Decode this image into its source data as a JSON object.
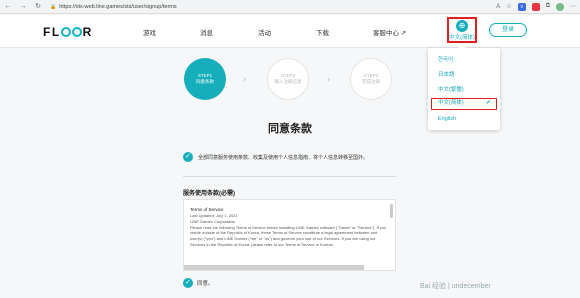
{
  "browser": {
    "url": "https://sts-web.line.games/sts/user/signup/terms"
  },
  "header": {
    "logo": [
      "FL",
      "O",
      "O",
      "R"
    ],
    "menu": [
      {
        "label": "游戏"
      },
      {
        "label": "消息"
      },
      {
        "label": "活动"
      },
      {
        "label": "下载"
      },
      {
        "label": "客服中心 ↗"
      }
    ],
    "language_button": "中文(简体)",
    "login": "登录"
  },
  "language_dropdown": {
    "options": [
      {
        "label": "한국어"
      },
      {
        "label": "日本語"
      },
      {
        "label": "中文(繁體)"
      },
      {
        "label": "中文(简体)",
        "selected": true
      },
      {
        "label": "English"
      }
    ]
  },
  "steps": [
    {
      "num": "STEP1",
      "label": "同意条款",
      "active": true
    },
    {
      "num": "STEP2",
      "label": "输入注册信息",
      "active": false
    },
    {
      "num": "STEP3",
      "label": "完成注册",
      "active": false
    }
  ],
  "page_title": "同意条款",
  "agree_all": "全部同意服务使用条款、收集及使用个人信息指南、将个人信息转移至国外。",
  "tos": {
    "section_title": "服务使用条款(必需)",
    "heading": "Terms of Service",
    "updated": "Last Updated: July 1, 2021",
    "company": "LINE Games Corporation",
    "body": "Please read the following Terms of Service before installing LINE Games software (\"Game\" or \"Service\"). If you reside outside of the Republic of Korea, these Terms of Service constitute a legal agreement between and user(s) (\"you\") and LINE Games (\"we\" or \"us\") and governs your use of our Services. If you are using our Services in the Republic of Korea, please refer to our Terms of Service in Korean."
  },
  "agree_label": "同意。",
  "watermark": "Bai 经验 | undecember"
}
